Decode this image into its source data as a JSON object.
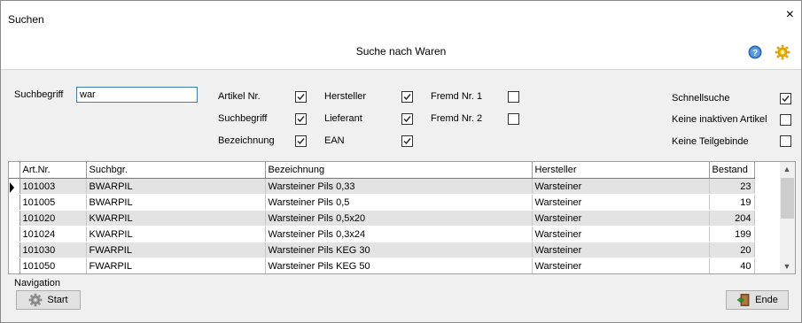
{
  "window": {
    "title": "Suchen",
    "close_glyph": "×"
  },
  "header": {
    "title": "Suche nach Waren",
    "help_icon": "help-icon",
    "gear_icon": "gear-icon"
  },
  "search": {
    "label": "Suchbegriff",
    "value": "war"
  },
  "filters": [
    {
      "label": "Artikel Nr.",
      "checked": true
    },
    {
      "label": "Suchbegriff",
      "checked": true
    },
    {
      "label": "Bezeichnung",
      "checked": true
    },
    {
      "label": "Hersteller",
      "checked": true
    },
    {
      "label": "Lieferant",
      "checked": true
    },
    {
      "label": "EAN",
      "checked": true
    },
    {
      "label": "Fremd Nr. 1",
      "checked": false
    },
    {
      "label": "Fremd Nr. 2",
      "checked": false
    }
  ],
  "options": [
    {
      "label": "Schnellsuche",
      "checked": true
    },
    {
      "label": "Keine inaktiven Artikel",
      "checked": false
    },
    {
      "label": "Keine Teilgebinde",
      "checked": false
    }
  ],
  "table": {
    "columns": [
      "Art.Nr.",
      "Suchbgr.",
      "Bezeichnung",
      "Hersteller",
      "Bestand"
    ],
    "rows": [
      [
        "101003",
        "BWARPIL",
        "Warsteiner Pils 0,33",
        "Warsteiner",
        "23"
      ],
      [
        "101005",
        "BWARPIL",
        "Warsteiner Pils 0,5",
        "Warsteiner",
        "19"
      ],
      [
        "101020",
        "KWARPIL",
        "Warsteiner Pils 0,5x20",
        "Warsteiner",
        "204"
      ],
      [
        "101024",
        "KWARPIL",
        "Warsteiner Pils 0,3x24",
        "Warsteiner",
        "199"
      ],
      [
        "101030",
        "FWARPIL",
        "Warsteiner Pils KEG 30",
        "Warsteiner",
        "20"
      ],
      [
        "101050",
        "FWARPIL",
        "Warsteiner Pils KEG 50",
        "Warsteiner",
        "40"
      ]
    ],
    "selected_row": 0
  },
  "navigation": {
    "label": "Navigation",
    "start_label": "Start",
    "end_label": "Ende"
  },
  "colors": {
    "row_alt": "#e3e3e3",
    "input_border": "#3c7fb1"
  }
}
